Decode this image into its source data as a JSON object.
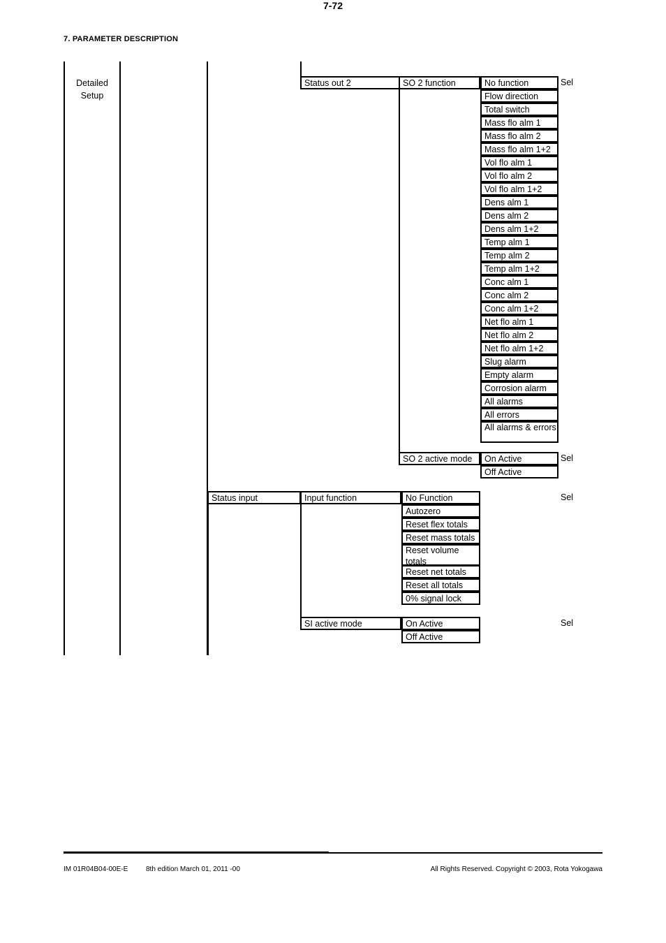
{
  "header": {
    "section_title": "7. PARAMETER DESCRIPTION"
  },
  "tree": {
    "root_label_line1": "Detailed",
    "root_label_line2": "Setup"
  },
  "groups": [
    {
      "name": "Status out 2",
      "parameters": [
        {
          "name": "SO 2 function",
          "access": "Sel",
          "options": [
            "No function",
            "Flow direction",
            "Total switch",
            "Mass flo alm 1",
            "Mass flo alm 2",
            "Mass flo alm 1+2",
            "Vol flo alm 1",
            "Vol flo alm 2",
            "Vol flo alm 1+2",
            "Dens alm 1",
            "Dens alm 2",
            "Dens alm 1+2",
            "Temp alm 1",
            "Temp alm 2",
            "Temp alm 1+2",
            "Conc alm 1",
            "Conc alm 2",
            "Conc alm 1+2",
            "Net flo alm 1",
            "Net flo alm 2",
            "Net flo alm 1+2",
            "Slug alarm",
            "Empty alarm",
            "Corrosion alarm",
            "All alarms",
            "All errors",
            "All alarms & errors"
          ]
        },
        {
          "name": "SO 2 active mode",
          "access": "Sel",
          "options": [
            "On Active",
            "Off Active"
          ]
        }
      ]
    },
    {
      "name": "Status input",
      "parameters": [
        {
          "name": "Input function",
          "access": "Sel",
          "options": [
            "No Function",
            "Autozero",
            "Reset flex totals",
            "Reset mass totals",
            "Reset volume totals",
            "Reset net totals",
            "Reset all totals",
            "0% signal lock"
          ]
        },
        {
          "name": "SI active mode",
          "access": "Sel",
          "options": [
            "On Active",
            "Off Active"
          ]
        }
      ]
    }
  ],
  "footer": {
    "doc_id": "IM 01R04B04-00E-E",
    "edition": "8th edition March 01, 2011 -00",
    "page_number": "7-72",
    "copyright": "All Rights Reserved. Copyright © 2003, Rota Yokogawa"
  }
}
